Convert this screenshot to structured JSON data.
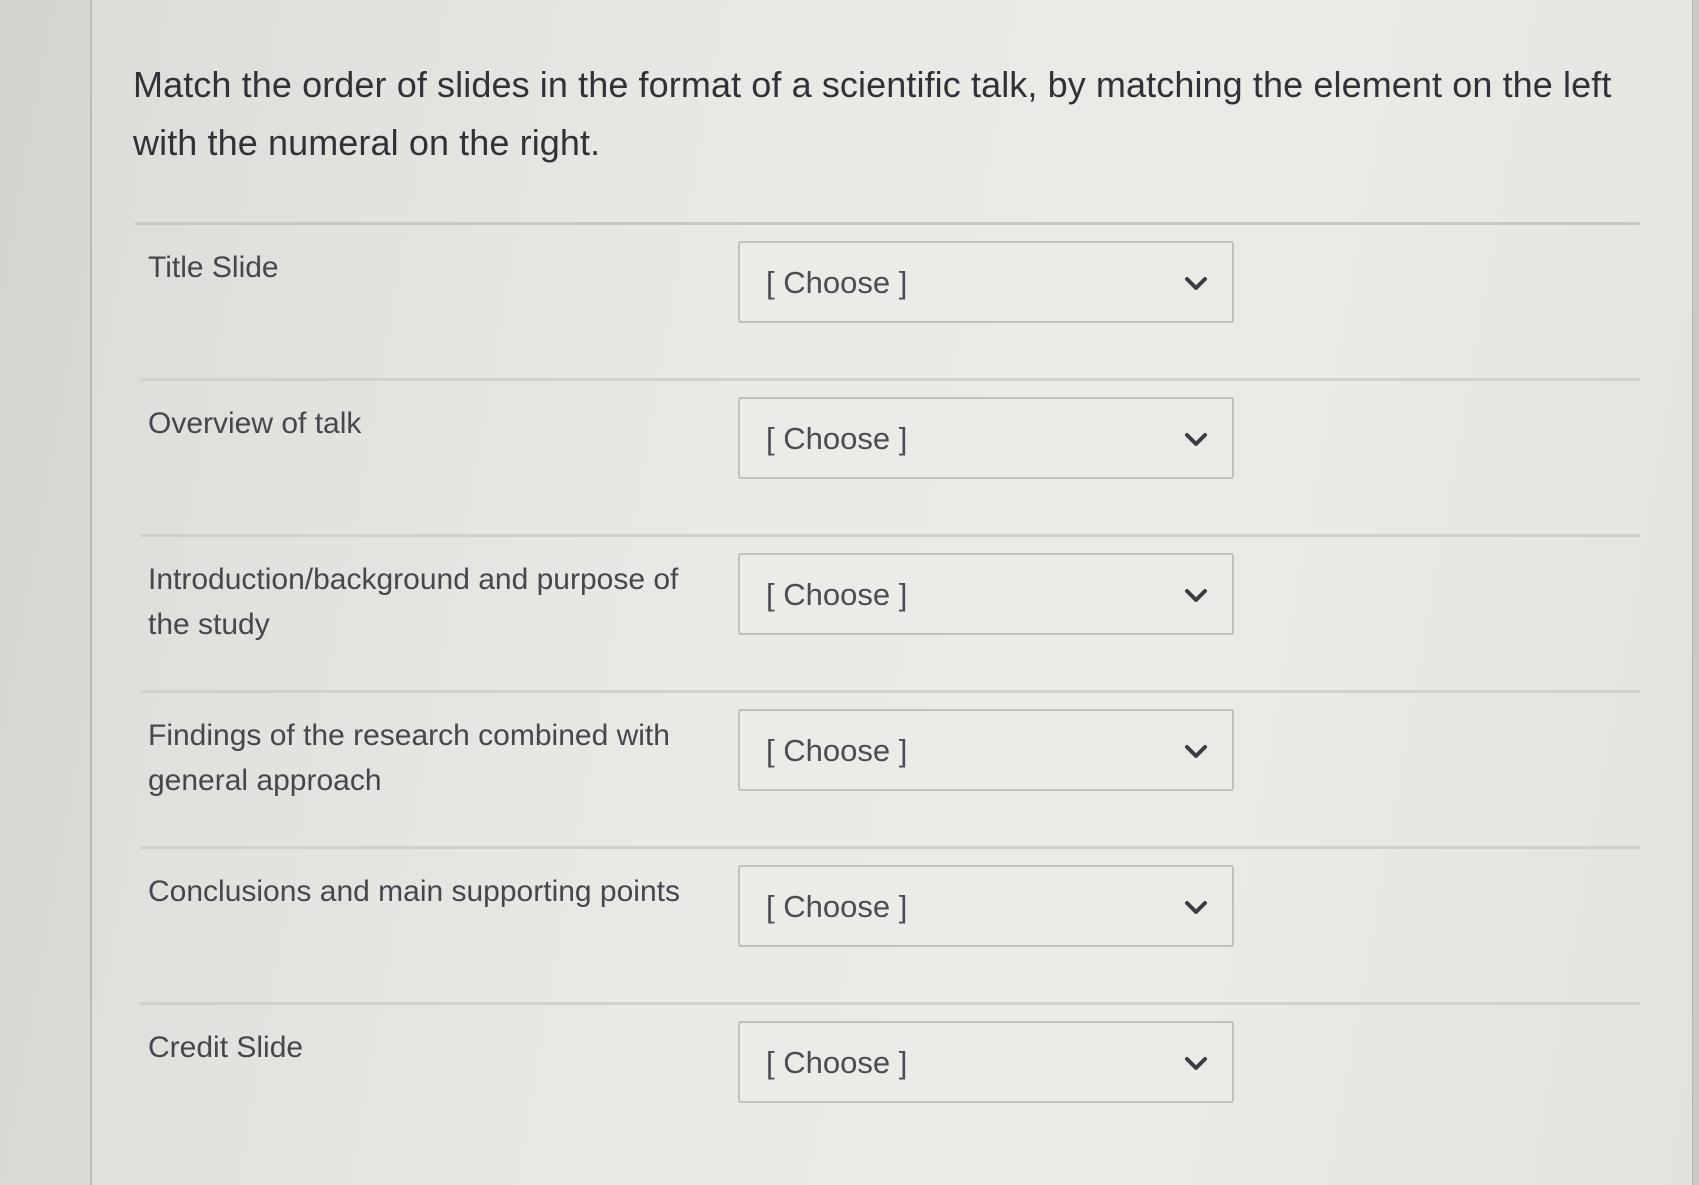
{
  "question": {
    "text": "Match the order of slides in the format of a scientific talk, by matching the element on the left with the numeral on the right."
  },
  "rows": [
    {
      "label": "Title Slide",
      "select_value": "[ Choose ]"
    },
    {
      "label": "Overview of talk",
      "select_value": "[ Choose ]"
    },
    {
      "label": "Introduction/background and purpose of the study",
      "select_value": "[ Choose ]"
    },
    {
      "label": "Findings of the research combined with general approach",
      "select_value": "[ Choose ]"
    },
    {
      "label": "Conclusions and main supporting points",
      "select_value": "[ Choose ]"
    },
    {
      "label": "Credit Slide",
      "select_value": "[ Choose ]"
    }
  ],
  "icons": {
    "select_arrow": "chevron-down-icon"
  },
  "colors": {
    "text": "#3f4347",
    "border": "#bfc1bd",
    "background": "#e9eae6"
  }
}
